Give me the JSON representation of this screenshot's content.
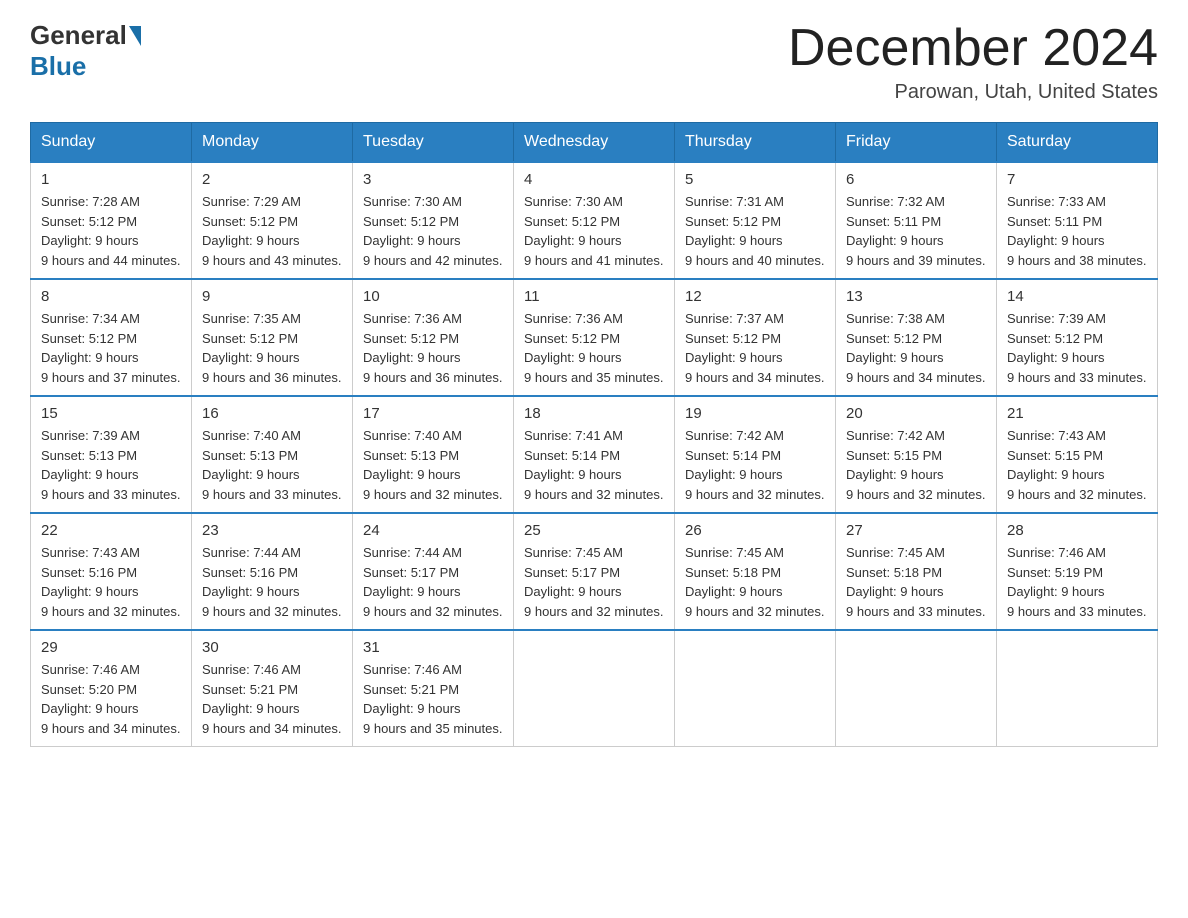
{
  "logo": {
    "general": "General",
    "blue": "Blue"
  },
  "title": "December 2024",
  "location": "Parowan, Utah, United States",
  "days_of_week": [
    "Sunday",
    "Monday",
    "Tuesday",
    "Wednesday",
    "Thursday",
    "Friday",
    "Saturday"
  ],
  "weeks": [
    [
      {
        "day": "1",
        "sunrise": "7:28 AM",
        "sunset": "5:12 PM",
        "daylight": "9 hours and 44 minutes."
      },
      {
        "day": "2",
        "sunrise": "7:29 AM",
        "sunset": "5:12 PM",
        "daylight": "9 hours and 43 minutes."
      },
      {
        "day": "3",
        "sunrise": "7:30 AM",
        "sunset": "5:12 PM",
        "daylight": "9 hours and 42 minutes."
      },
      {
        "day": "4",
        "sunrise": "7:30 AM",
        "sunset": "5:12 PM",
        "daylight": "9 hours and 41 minutes."
      },
      {
        "day": "5",
        "sunrise": "7:31 AM",
        "sunset": "5:12 PM",
        "daylight": "9 hours and 40 minutes."
      },
      {
        "day": "6",
        "sunrise": "7:32 AM",
        "sunset": "5:11 PM",
        "daylight": "9 hours and 39 minutes."
      },
      {
        "day": "7",
        "sunrise": "7:33 AM",
        "sunset": "5:11 PM",
        "daylight": "9 hours and 38 minutes."
      }
    ],
    [
      {
        "day": "8",
        "sunrise": "7:34 AM",
        "sunset": "5:12 PM",
        "daylight": "9 hours and 37 minutes."
      },
      {
        "day": "9",
        "sunrise": "7:35 AM",
        "sunset": "5:12 PM",
        "daylight": "9 hours and 36 minutes."
      },
      {
        "day": "10",
        "sunrise": "7:36 AM",
        "sunset": "5:12 PM",
        "daylight": "9 hours and 36 minutes."
      },
      {
        "day": "11",
        "sunrise": "7:36 AM",
        "sunset": "5:12 PM",
        "daylight": "9 hours and 35 minutes."
      },
      {
        "day": "12",
        "sunrise": "7:37 AM",
        "sunset": "5:12 PM",
        "daylight": "9 hours and 34 minutes."
      },
      {
        "day": "13",
        "sunrise": "7:38 AM",
        "sunset": "5:12 PM",
        "daylight": "9 hours and 34 minutes."
      },
      {
        "day": "14",
        "sunrise": "7:39 AM",
        "sunset": "5:12 PM",
        "daylight": "9 hours and 33 minutes."
      }
    ],
    [
      {
        "day": "15",
        "sunrise": "7:39 AM",
        "sunset": "5:13 PM",
        "daylight": "9 hours and 33 minutes."
      },
      {
        "day": "16",
        "sunrise": "7:40 AM",
        "sunset": "5:13 PM",
        "daylight": "9 hours and 33 minutes."
      },
      {
        "day": "17",
        "sunrise": "7:40 AM",
        "sunset": "5:13 PM",
        "daylight": "9 hours and 32 minutes."
      },
      {
        "day": "18",
        "sunrise": "7:41 AM",
        "sunset": "5:14 PM",
        "daylight": "9 hours and 32 minutes."
      },
      {
        "day": "19",
        "sunrise": "7:42 AM",
        "sunset": "5:14 PM",
        "daylight": "9 hours and 32 minutes."
      },
      {
        "day": "20",
        "sunrise": "7:42 AM",
        "sunset": "5:15 PM",
        "daylight": "9 hours and 32 minutes."
      },
      {
        "day": "21",
        "sunrise": "7:43 AM",
        "sunset": "5:15 PM",
        "daylight": "9 hours and 32 minutes."
      }
    ],
    [
      {
        "day": "22",
        "sunrise": "7:43 AM",
        "sunset": "5:16 PM",
        "daylight": "9 hours and 32 minutes."
      },
      {
        "day": "23",
        "sunrise": "7:44 AM",
        "sunset": "5:16 PM",
        "daylight": "9 hours and 32 minutes."
      },
      {
        "day": "24",
        "sunrise": "7:44 AM",
        "sunset": "5:17 PM",
        "daylight": "9 hours and 32 minutes."
      },
      {
        "day": "25",
        "sunrise": "7:45 AM",
        "sunset": "5:17 PM",
        "daylight": "9 hours and 32 minutes."
      },
      {
        "day": "26",
        "sunrise": "7:45 AM",
        "sunset": "5:18 PM",
        "daylight": "9 hours and 32 minutes."
      },
      {
        "day": "27",
        "sunrise": "7:45 AM",
        "sunset": "5:18 PM",
        "daylight": "9 hours and 33 minutes."
      },
      {
        "day": "28",
        "sunrise": "7:46 AM",
        "sunset": "5:19 PM",
        "daylight": "9 hours and 33 minutes."
      }
    ],
    [
      {
        "day": "29",
        "sunrise": "7:46 AM",
        "sunset": "5:20 PM",
        "daylight": "9 hours and 34 minutes."
      },
      {
        "day": "30",
        "sunrise": "7:46 AM",
        "sunset": "5:21 PM",
        "daylight": "9 hours and 34 minutes."
      },
      {
        "day": "31",
        "sunrise": "7:46 AM",
        "sunset": "5:21 PM",
        "daylight": "9 hours and 35 minutes."
      },
      null,
      null,
      null,
      null
    ]
  ]
}
